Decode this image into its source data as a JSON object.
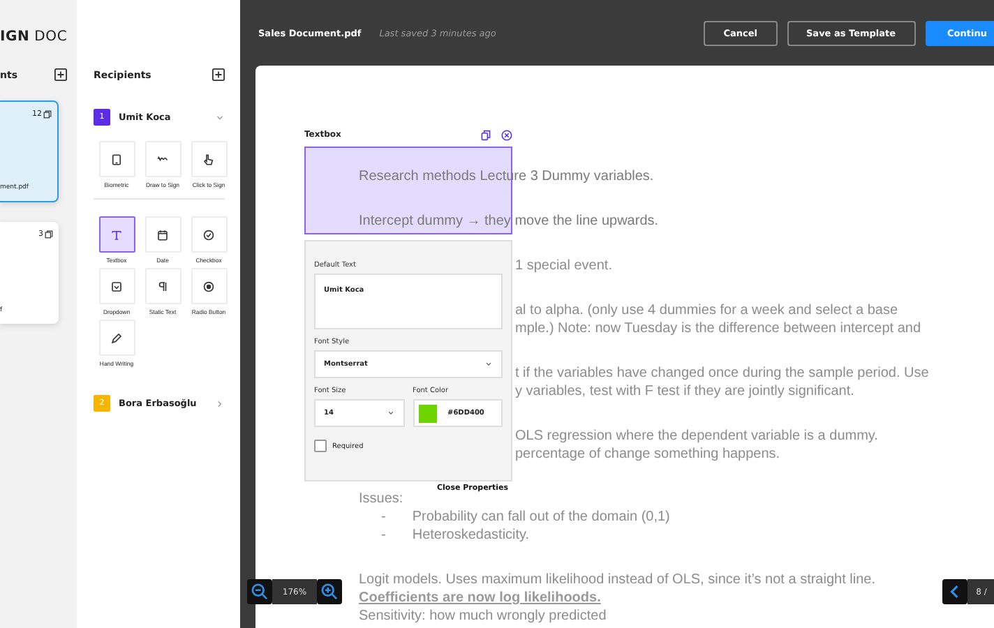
{
  "logo": {
    "bold": "IGN",
    "light": "DOC"
  },
  "documents": {
    "title": "nts",
    "cards": [
      {
        "pages": "12",
        "name": "ment.pdf",
        "selected": true
      },
      {
        "pages": "3",
        "name": "f",
        "selected": false
      }
    ]
  },
  "recipients": {
    "title": "Recipients",
    "items": [
      {
        "number": "1",
        "name": "Umit Koca",
        "color": "#5b2ee6",
        "expanded": true,
        "groups": [
          [
            {
              "kind": "biometric",
              "label": "Biometric",
              "selected": false
            },
            {
              "kind": "draw",
              "label": "Draw to Sign",
              "selected": false
            },
            {
              "kind": "click",
              "label": "Click to Sign",
              "selected": false
            }
          ],
          [
            {
              "kind": "textbox",
              "label": "Textbox",
              "selected": true
            },
            {
              "kind": "date",
              "label": "Date",
              "selected": false
            },
            {
              "kind": "checkbox",
              "label": "Checkbox",
              "selected": false
            },
            {
              "kind": "dropdown",
              "label": "Dropdown",
              "selected": false
            },
            {
              "kind": "static",
              "label": "Static Text",
              "selected": false
            },
            {
              "kind": "radio",
              "label": "Radio Button",
              "selected": false
            },
            {
              "kind": "handwriting",
              "label": "Hand Writing",
              "selected": false
            }
          ]
        ]
      },
      {
        "number": "2",
        "name": "Bora Erbasoğlu",
        "color": "#f7b500",
        "expanded": false
      }
    ]
  },
  "topbar": {
    "file_name": "Sales Document.pdf",
    "last_saved": "Last saved 3 minutes ago",
    "buttons": [
      {
        "label": "Cancel",
        "kind": "outline"
      },
      {
        "label": "Save as Template",
        "kind": "outline"
      },
      {
        "label": "Continu",
        "kind": "primary"
      }
    ]
  },
  "document": {
    "paragraphs": [
      {
        "lines": [
          {
            "text": "Research methods Lecture 3 Dummy variables.",
            "kind": "plain"
          }
        ]
      },
      {
        "lines": [
          {
            "text": "Intercept dummy → they move the line upwards.",
            "kind": "plain"
          }
        ]
      },
      {
        "lines": [
          {
            "text": "1 special event.",
            "kind": "fragment"
          }
        ]
      },
      {
        "lines": [
          {
            "text": "al to alpha. (only use 4 dummies for a week and select a base",
            "kind": "fragment"
          },
          {
            "text": "mple.) Note: now Tuesday is the difference between intercept and",
            "kind": "fragment"
          }
        ]
      },
      {
        "lines": [
          {
            "text": "t if the variables have changed once during the sample period. Use",
            "kind": "fragment"
          },
          {
            "text": "y variables, test with F test if they are jointly significant.",
            "kind": "fragment"
          }
        ]
      },
      {
        "lines": [
          {
            "text": "OLS regression where the dependent variable is a dummy.",
            "kind": "fragment"
          },
          {
            "text": "percentage of change something happens.",
            "kind": "fragment"
          }
        ]
      },
      {
        "lines": [
          {
            "text": "Issues:",
            "kind": "plain"
          },
          {
            "text": "Probability can fall out of the domain (0,1)",
            "kind": "bullet",
            "marker": "-"
          },
          {
            "text": "Heteroskedasticity.",
            "kind": "bullet",
            "marker": "-"
          }
        ]
      },
      {
        "lines": [
          {
            "text": "Logit models. Uses maximum likelihood instead of OLS, since it’s not a straight line.",
            "kind": "plain"
          },
          {
            "text": "Coefficients are now log likelihoods.",
            "kind": "emphasis"
          },
          {
            "text": "Sensitivity: how much wrongly predicted",
            "kind": "plain"
          }
        ]
      }
    ]
  },
  "field": {
    "title": "Textbox"
  },
  "properties": {
    "default_text": {
      "label": "Default Text",
      "value": "Umit Koca"
    },
    "font_style": {
      "label": "Font Style",
      "value": "Montserrat"
    },
    "font_size": {
      "label": "Font Size",
      "value": "14"
    },
    "font_color": {
      "label": "Font Color",
      "value": "#6DD400"
    },
    "required": {
      "label": "Required",
      "checked": false
    },
    "close": "Close Properties"
  },
  "zoom": {
    "value": "176%"
  },
  "pager": {
    "text": "8 /"
  }
}
